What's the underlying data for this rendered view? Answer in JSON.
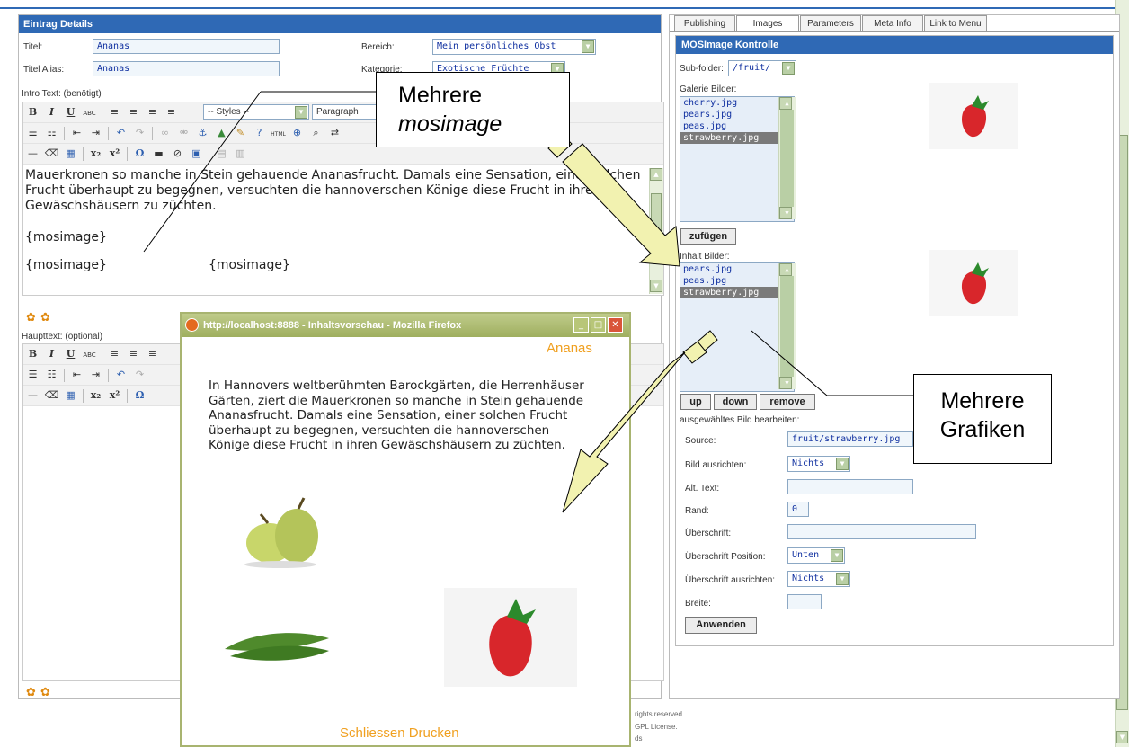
{
  "left": {
    "header": "Eintrag Details",
    "titel_label": "Titel:",
    "titel_value": "Ananas",
    "alias_label": "Titel Alias:",
    "alias_value": "Ananas",
    "bereich_label": "Bereich:",
    "bereich_value": "Mein persönliches Obst",
    "kategorie_label": "Kategorie:",
    "kategorie_value": "Exotische Früchte",
    "intro_label": "Intro Text: (benötigt)",
    "styles_value": "-- Styles --",
    "paragraph_value": "Paragraph",
    "intro_text": "Mauerkronen so manche in Stein gehauende Ananasfrucht. Damals eine Sensation, einer solchen Frucht überhaupt zu begegnen, versuchten die hannoverschen Könige diese Frucht in ihren Gewäschshäusern zu züchten.",
    "mosimage_1": "{mosimage}",
    "mosimage_2": "{mosimage}",
    "mosimage_3": "{mosimage}",
    "haupttext_label": "Haupttext: (optional)"
  },
  "right": {
    "tabs": [
      "Publishing",
      "Images",
      "Parameters",
      "Meta Info",
      "Link to Menu"
    ],
    "mos_header": "MOSImage Kontrolle",
    "subfolder_label": "Sub-folder:",
    "subfolder_value": "/fruit/",
    "galerie_label": "Galerie Bilder:",
    "galerie_items": [
      "cherry.jpg",
      "pears.jpg",
      "peas.jpg",
      "strawberry.jpg"
    ],
    "zufuegen": "zufügen",
    "inhalt_label": "Inhalt Bilder:",
    "inhalt_items": [
      "pears.jpg",
      "peas.jpg",
      "strawberry.jpg"
    ],
    "btn_up": "up",
    "btn_down": "down",
    "btn_remove": "remove",
    "edit_label": "ausgewähltes Bild bearbeiten:",
    "source_label": "Source:",
    "source_value": "fruit/strawberry.jpg",
    "align_label": "Bild ausrichten:",
    "align_value": "Nichts",
    "alt_label": "Alt. Text:",
    "rand_label": "Rand:",
    "rand_value": "0",
    "caption_label": "Überschrift:",
    "caption_pos_label": "Überschrift Position:",
    "caption_pos_value": "Unten",
    "caption_align_label": "Überschrift ausrichten:",
    "caption_align_value": "Nichts",
    "width_label": "Breite:",
    "apply": "Anwenden"
  },
  "popup": {
    "title": "http://localhost:8888 - Inhaltsvorschau - Mozilla Firefox",
    "heading": "Ananas",
    "body": "In Hannovers weltberühmten Barockgärten, die Herrenhäuser Gärten, ziert die Mauerkronen so manche in Stein gehauende Ananasfrucht. Damals eine Sensation, einer solchen Frucht überhaupt zu begegnen, versuchten die hannoverschen Könige diese Frucht in ihren Gewäschshäusern zu züchten.",
    "close": "Schliessen",
    "print": "Drucken"
  },
  "callouts": {
    "mosimage_line1": "Mehrere",
    "mosimage_line2": "mosimage",
    "grafiken_line1": "Mehrere",
    "grafiken_line2": "Grafiken"
  },
  "footer": {
    "line1": "rights reserved.",
    "line2": "GPL License.",
    "line3": "ds"
  },
  "colors": {
    "header_blue": "#2f69b5",
    "accent_orange": "#f0a020",
    "arrow_fill": "#f2f2b0"
  }
}
